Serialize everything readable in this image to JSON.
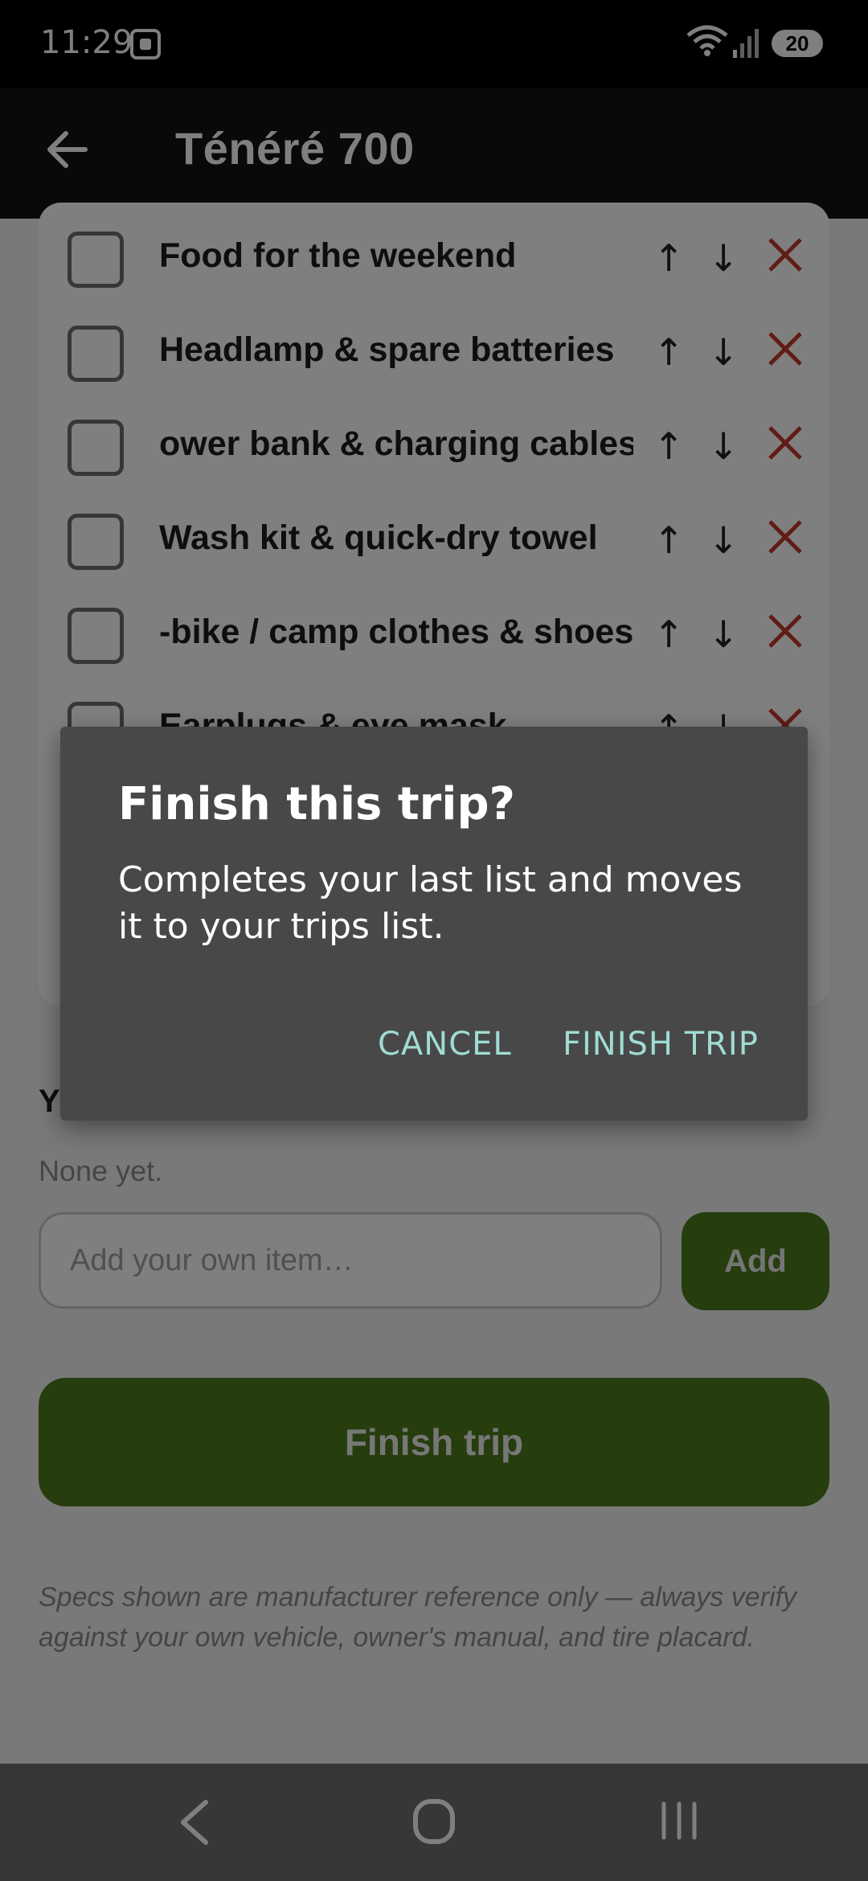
{
  "status_bar": {
    "time": "11:29",
    "battery": "20"
  },
  "app_bar": {
    "title": "Ténéré 700"
  },
  "checklist": {
    "items": [
      {
        "label": "Food for the weekend"
      },
      {
        "label": "Headlamp & spare batteries"
      },
      {
        "label": "ower bank & charging cables"
      },
      {
        "label": "Wash kit & quick-dry towel"
      },
      {
        "label": "-bike / camp clothes & shoes"
      },
      {
        "label": "Earplugs & eye mask"
      }
    ],
    "move_up_glyph": "↑",
    "move_down_glyph": "↓",
    "delete_color": "#c0392b"
  },
  "custom_items": {
    "heading": "Y",
    "empty_text": "None yet.",
    "input_placeholder": "Add your own item…",
    "add_label": "Add"
  },
  "finish_button": {
    "label": "Finish trip"
  },
  "disclaimer": "Specs shown are manufacturer reference only — always verify against your own vehicle, owner's manual, and tire placard.",
  "dialog": {
    "title": "Finish this trip?",
    "body": "Completes your last list and moves it to your trips list.",
    "cancel_label": "CANCEL",
    "confirm_label": "FINISH TRIP"
  },
  "colors": {
    "accent_green": "#4d7b1d",
    "dialog_button_teal": "#9fdcd4"
  }
}
